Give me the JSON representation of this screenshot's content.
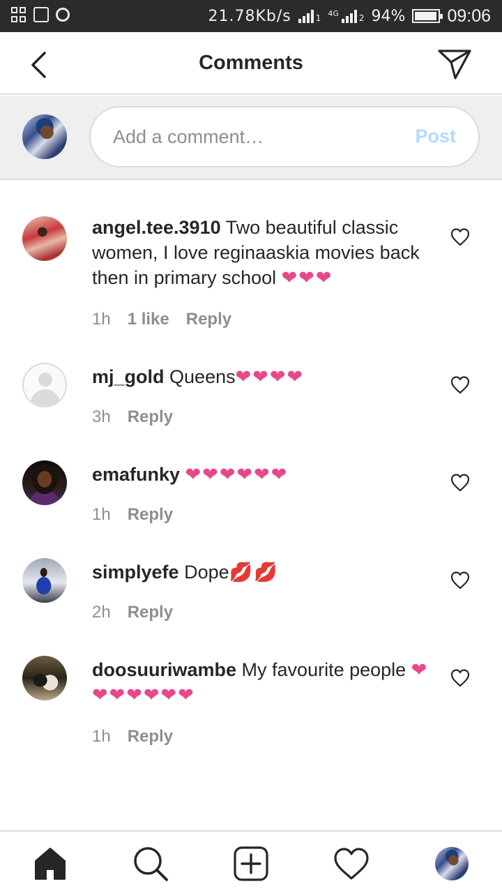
{
  "status_bar": {
    "speed": "21.78Kb/s",
    "sim1_tag": "1",
    "sim2_label": "4G",
    "sim2_tag": "2",
    "battery": "94%",
    "battery_level": 0.94,
    "time": "09:06"
  },
  "header": {
    "title": "Comments",
    "back_icon": "chevron-left-icon",
    "share_icon": "paper-plane-icon"
  },
  "composer": {
    "placeholder": "Add a comment…",
    "post_label": "Post",
    "post_color": "#b3dbff"
  },
  "comments": [
    {
      "username": "angel.tee.3910",
      "text": "Two beautiful classic women, I love reginaaskia movies back then in primary school",
      "emoji": "❤❤❤",
      "time": "1h",
      "likes": "1 like",
      "reply": "Reply"
    },
    {
      "username": "mj_gold",
      "text": "Queens",
      "emoji": "❤❤❤❤",
      "time": "3h",
      "likes": "",
      "reply": "Reply"
    },
    {
      "username": "emafunky",
      "text": "",
      "emoji": "❤❤❤❤❤❤",
      "time": "1h",
      "likes": "",
      "reply": "Reply"
    },
    {
      "username": "simplyefe",
      "text": "Dope",
      "emoji": "💋💋",
      "time": "2h",
      "likes": "",
      "reply": "Reply"
    },
    {
      "username": "doosuuriwambe",
      "text": "My favourite people",
      "emoji": "❤❤❤❤❤❤❤",
      "time": "1h",
      "likes": "",
      "reply": "Reply"
    }
  ],
  "bottom_nav": {
    "items": [
      "home-icon",
      "search-icon",
      "new-post-icon",
      "activity-heart-icon",
      "profile-avatar"
    ]
  },
  "colors": {
    "text": "#262626",
    "muted": "#8e8e8e",
    "divider": "#dbdbdb",
    "emoji_pink": "#e8488a",
    "status_bar_bg": "#2b2b2b"
  }
}
